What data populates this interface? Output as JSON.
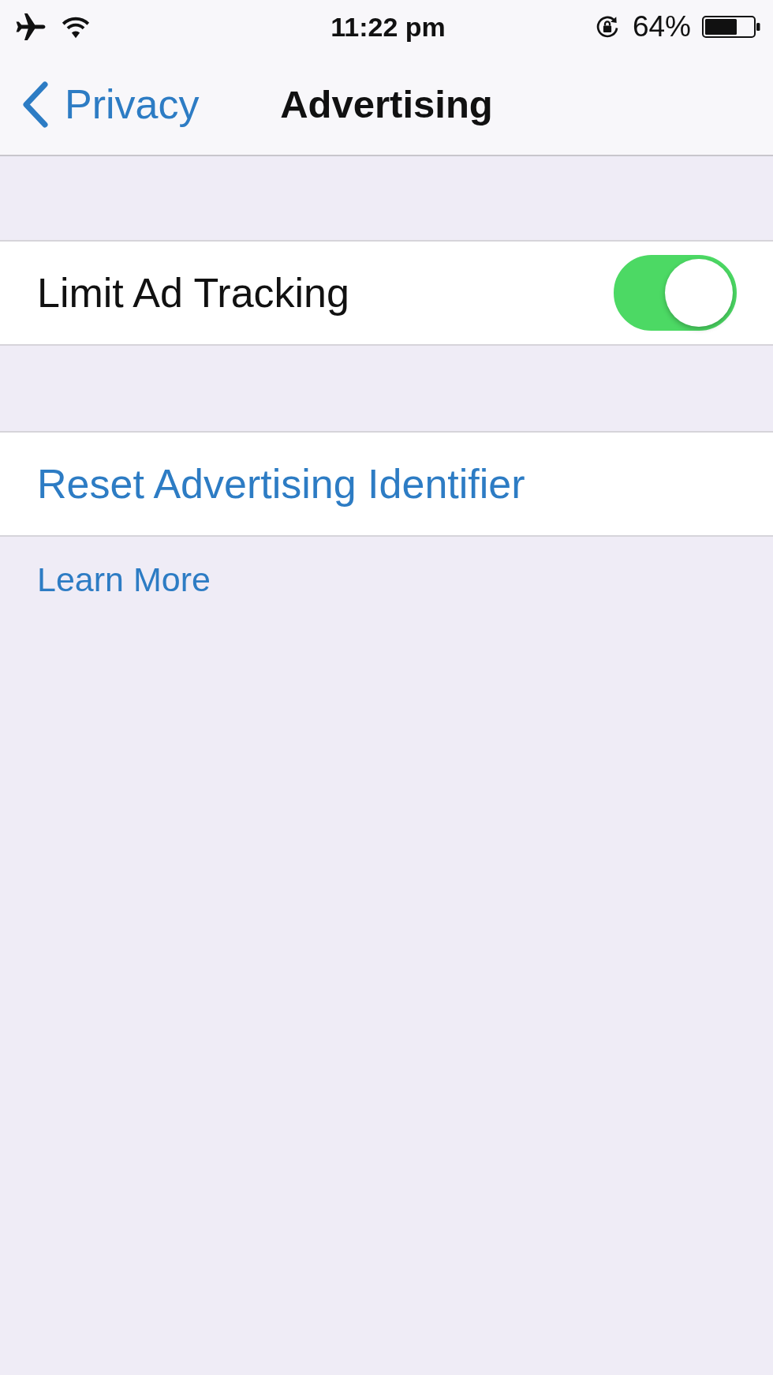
{
  "status_bar": {
    "time": "11:22 pm",
    "battery_percent": "64%"
  },
  "nav_bar": {
    "back_label": "Privacy",
    "title": "Advertising"
  },
  "sections": [
    {
      "rows": [
        {
          "kind": "toggle",
          "label": "Limit Ad Tracking",
          "on": true
        }
      ]
    },
    {
      "rows": [
        {
          "kind": "button",
          "label": "Reset Advertising Identifier"
        }
      ]
    }
  ],
  "footer_link": "Learn More"
}
